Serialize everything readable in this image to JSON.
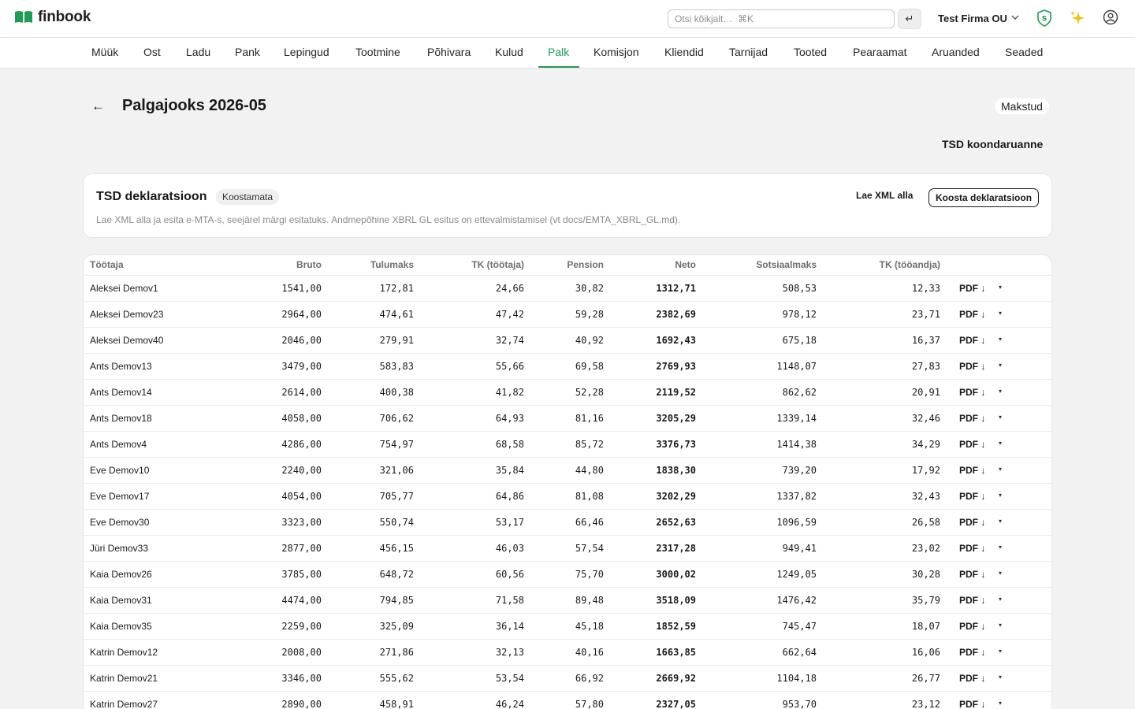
{
  "app": {
    "name": "finbook"
  },
  "search": {
    "placeholder": "Otsi kõikjalt…  ⌘K",
    "enter_glyph": "↵"
  },
  "company": {
    "name": "Test Firma OU",
    "chevron": "⌵"
  },
  "colors": {
    "accent": "#1f9d55"
  },
  "icons": {
    "logo": "open-book-icon",
    "security": "shield-icon",
    "ai": "sparkle-icon",
    "user": "user-circle-icon",
    "back": "arrow-left-icon",
    "download": "arrow-down-icon",
    "menu": "caret-down-icon"
  },
  "nav": {
    "active": "Palk",
    "items": [
      "Müük",
      "Ost",
      "Ladu",
      "Pank",
      "Lepingud",
      "Tootmine",
      "Põhivara",
      "Kulud",
      "Palk",
      "Komisjon",
      "Kliendid",
      "Tarnijad",
      "Tooted",
      "Pearaamat",
      "Aruanded",
      "Seaded"
    ]
  },
  "page": {
    "back_glyph": "←",
    "title": "Palgajooks 2026-05",
    "status": "Makstud",
    "report_link": "TSD koondaruanne"
  },
  "tsd": {
    "title": "TSD deklaratsioon",
    "badge": "Koostamata",
    "description": "Lae XML alla ja esita e-MTA-s, seejärel märgi esitatuks. Andmepõhine XBRL GL esitus on ettevalmistamisel (vt docs/EMTA_XBRL_GL.md).",
    "download_xml": "Lae XML alla",
    "compose": "Koosta deklaratsioon"
  },
  "table": {
    "headers": [
      "Töötaja",
      "Bruto",
      "Tulumaks",
      "TK (töötaja)",
      "Pension",
      "Neto",
      "Sotsiaalmaks",
      "TK (tööandja)"
    ],
    "pdf_label": "PDF ↓",
    "caret": "▾",
    "rows": [
      [
        "Aleksei Demov1",
        "1541,00",
        "172,81",
        "24,66",
        "30,82",
        "1312,71",
        "508,53",
        "12,33"
      ],
      [
        "Aleksei Demov23",
        "2964,00",
        "474,61",
        "47,42",
        "59,28",
        "2382,69",
        "978,12",
        "23,71"
      ],
      [
        "Aleksei Demov40",
        "2046,00",
        "279,91",
        "32,74",
        "40,92",
        "1692,43",
        "675,18",
        "16,37"
      ],
      [
        "Ants Demov13",
        "3479,00",
        "583,83",
        "55,66",
        "69,58",
        "2769,93",
        "1148,07",
        "27,83"
      ],
      [
        "Ants Demov14",
        "2614,00",
        "400,38",
        "41,82",
        "52,28",
        "2119,52",
        "862,62",
        "20,91"
      ],
      [
        "Ants Demov18",
        "4058,00",
        "706,62",
        "64,93",
        "81,16",
        "3205,29",
        "1339,14",
        "32,46"
      ],
      [
        "Ants Demov4",
        "4286,00",
        "754,97",
        "68,58",
        "85,72",
        "3376,73",
        "1414,38",
        "34,29"
      ],
      [
        "Eve Demov10",
        "2240,00",
        "321,06",
        "35,84",
        "44,80",
        "1838,30",
        "739,20",
        "17,92"
      ],
      [
        "Eve Demov17",
        "4054,00",
        "705,77",
        "64,86",
        "81,08",
        "3202,29",
        "1337,82",
        "32,43"
      ],
      [
        "Eve Demov30",
        "3323,00",
        "550,74",
        "53,17",
        "66,46",
        "2652,63",
        "1096,59",
        "26,58"
      ],
      [
        "Jüri Demov33",
        "2877,00",
        "456,15",
        "46,03",
        "57,54",
        "2317,28",
        "949,41",
        "23,02"
      ],
      [
        "Kaia Demov26",
        "3785,00",
        "648,72",
        "60,56",
        "75,70",
        "3000,02",
        "1249,05",
        "30,28"
      ],
      [
        "Kaia Demov31",
        "4474,00",
        "794,85",
        "71,58",
        "89,48",
        "3518,09",
        "1476,42",
        "35,79"
      ],
      [
        "Kaia Demov35",
        "2259,00",
        "325,09",
        "36,14",
        "45,18",
        "1852,59",
        "745,47",
        "18,07"
      ],
      [
        "Katrin Demov12",
        "2008,00",
        "271,86",
        "32,13",
        "40,16",
        "1663,85",
        "662,64",
        "16,06"
      ],
      [
        "Katrin Demov21",
        "3346,00",
        "555,62",
        "53,54",
        "66,92",
        "2669,92",
        "1104,18",
        "26,77"
      ],
      [
        "Katrin Demov27",
        "2890,00",
        "458,91",
        "46,24",
        "57,80",
        "2327,05",
        "953,70",
        "23,12"
      ]
    ]
  }
}
